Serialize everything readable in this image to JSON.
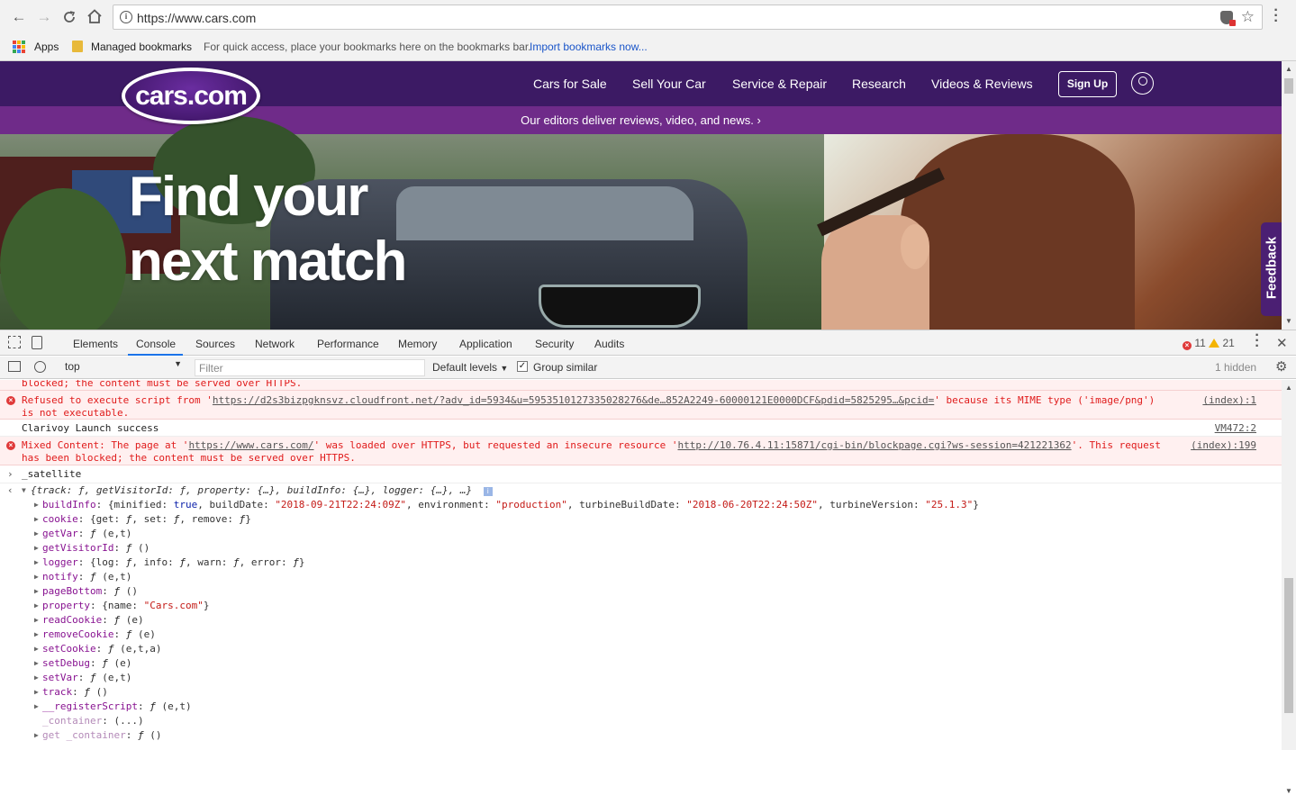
{
  "browser": {
    "url": "https://www.cars.com",
    "bookmarks": {
      "apps": "Apps",
      "managed": "Managed bookmarks",
      "hint": "For quick access, place your bookmarks here on the bookmarks bar.",
      "import": "Import bookmarks now..."
    }
  },
  "site": {
    "logo": "cars.com",
    "nav": [
      "Cars for Sale",
      "Sell Your Car",
      "Service & Repair",
      "Research",
      "Videos & Reviews"
    ],
    "signup": "Sign Up",
    "promo": "Our editors deliver reviews, video, and news.",
    "promo_chevron": "›",
    "hero_line1": "Find your",
    "hero_line2": "next match",
    "feedback": "Feedback"
  },
  "devtools": {
    "tabs": [
      "Elements",
      "Console",
      "Sources",
      "Network",
      "Performance",
      "Memory",
      "Application",
      "Security",
      "Audits"
    ],
    "active_tab": "Console",
    "errors": "11",
    "warnings": "21",
    "context": "top",
    "filter_placeholder": "Filter",
    "levels": "Default levels",
    "group_similar": "Group similar",
    "hidden": "1 hidden"
  },
  "console": {
    "msg0": "blocked; the content must be served over HTTPS.",
    "msg1": {
      "pre": "Refused to execute script from '",
      "link": "https://d2s3bizpgknsvz.cloudfront.net/?adv_id=5934&u=595351012733502827​6&de…852A2249-60000121E0000DCF&pdid=5825295…&pcid=",
      "post": "' because its MIME type ('image/png') is not executable.",
      "src": "(index):1"
    },
    "msg2": {
      "text": "Clarivoy Launch success",
      "src": "VM472:2"
    },
    "msg3": {
      "pre": "Mixed Content: The page at '",
      "link1": "https://www.cars.com/",
      "mid": "' was loaded over HTTPS, but requested an insecure resource '",
      "link2": "http://10.76.4.11:15871/cgi-bin/blockpage.cgi?ws-session=421221362",
      "post": "'. This request has been blocked; the content must be served over HTTPS.",
      "src": "(index):199"
    },
    "input": "_satellite",
    "summary": "{track: ƒ, getVisitorId: ƒ, property: {…}, buildInfo: {…}, logger: {…}, …}",
    "props": [
      {
        "k": "buildInfo",
        "v": "{minified: true, buildDate: \"2018-09-21T22:24:09Z\", environment: \"production\", turbineBuildDate: \"2018-06-20T22:24:50Z\", turbineVersion: \"25.1.3\"}"
      },
      {
        "k": "cookie",
        "v": "{get: ƒ, set: ƒ, remove: ƒ}"
      },
      {
        "k": "getVar",
        "v": "ƒ (e,t)"
      },
      {
        "k": "getVisitorId",
        "v": "ƒ ()"
      },
      {
        "k": "logger",
        "v": "{log: ƒ, info: ƒ, warn: ƒ, error: ƒ}"
      },
      {
        "k": "notify",
        "v": "ƒ (e,t)"
      },
      {
        "k": "pageBottom",
        "v": "ƒ ()"
      },
      {
        "k": "property",
        "v": "{name: \"Cars.com\"}"
      },
      {
        "k": "readCookie",
        "v": "ƒ (e)"
      },
      {
        "k": "removeCookie",
        "v": "ƒ (e)"
      },
      {
        "k": "setCookie",
        "v": "ƒ (e,t,a)"
      },
      {
        "k": "setDebug",
        "v": "ƒ (e)"
      },
      {
        "k": "setVar",
        "v": "ƒ (e,t)"
      },
      {
        "k": "track",
        "v": "ƒ ()"
      },
      {
        "k": "__registerScript",
        "v": "ƒ (e,t)"
      },
      {
        "k": "_container",
        "v": "(...)"
      },
      {
        "k": "get _container",
        "v": "ƒ ()"
      }
    ]
  },
  "colors": {
    "nav_bg": "#3c1a64",
    "promo_bg": "#6f2b89",
    "error_bg": "#fff0f0",
    "error_text": "#e01b1b"
  }
}
